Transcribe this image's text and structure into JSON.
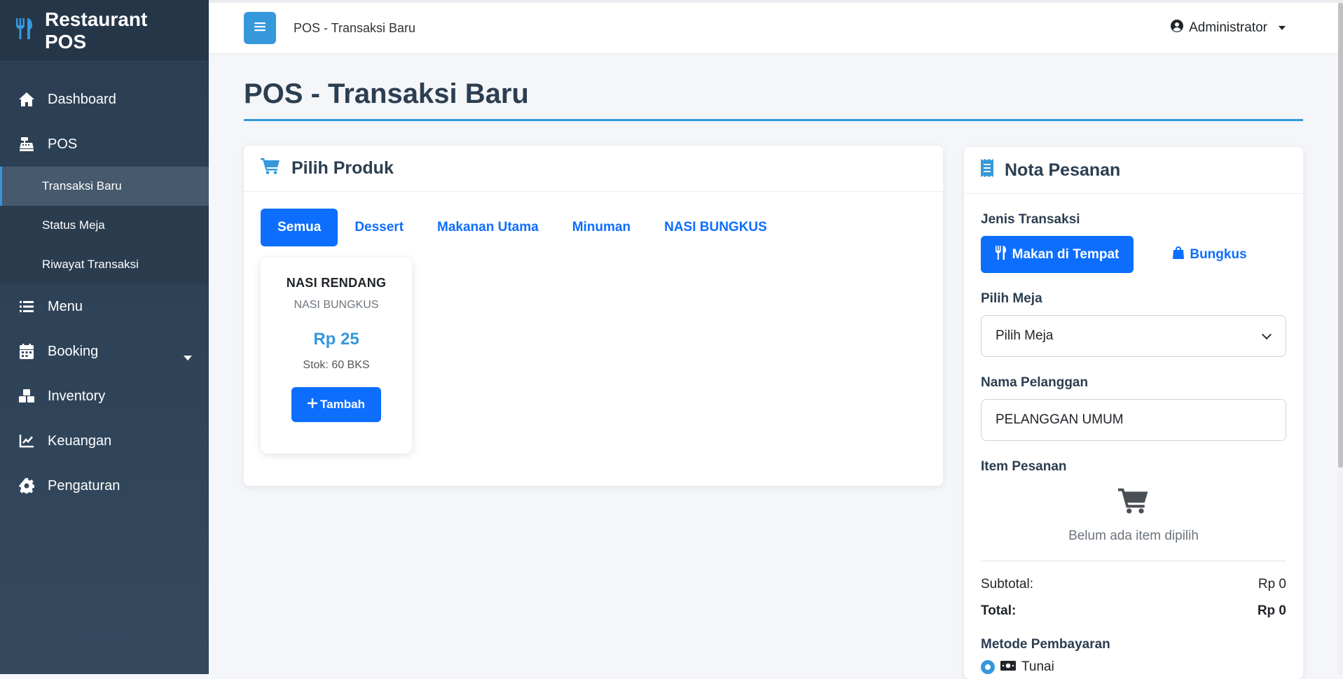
{
  "app": {
    "brand": "Restaurant POS"
  },
  "sidebar": {
    "items": [
      {
        "label": "Dashboard",
        "icon": "home-icon"
      },
      {
        "label": "POS",
        "icon": "cash-register-icon"
      },
      {
        "label": "Menu",
        "icon": "list-icon"
      },
      {
        "label": "Booking",
        "icon": "calendar-icon"
      },
      {
        "label": "Inventory",
        "icon": "boxes-icon"
      },
      {
        "label": "Keuangan",
        "icon": "chart-line-icon"
      },
      {
        "label": "Pengaturan",
        "icon": "gear-icon"
      }
    ],
    "pos_sub": [
      {
        "label": "Transaksi Baru"
      },
      {
        "label": "Status Meja"
      },
      {
        "label": "Riwayat Transaksi"
      }
    ]
  },
  "topbar": {
    "title": "POS - Transaksi Baru",
    "user": "Administrator"
  },
  "page": {
    "title": "POS - Transaksi Baru"
  },
  "products": {
    "header": "Pilih Produk",
    "tabs": [
      "Semua",
      "Dessert",
      "Makanan Utama",
      "Minuman",
      "NASI BUNGKUS"
    ],
    "items": [
      {
        "name": "NASI RENDANG",
        "category": "NASI BUNGKUS",
        "price": "Rp 25",
        "stock": "Stok: 60 BKS",
        "button": "Tambah"
      }
    ]
  },
  "order": {
    "header": "Nota Pesanan",
    "type_label": "Jenis Transaksi",
    "type_dine_in": "Makan di Tempat",
    "type_takeaway": "Bungkus",
    "table_label": "Pilih Meja",
    "table_value": "Pilih Meja",
    "customer_label": "Nama Pelanggan",
    "customer_value": "PELANGGAN UMUM",
    "items_label": "Item Pesanan",
    "empty_text": "Belum ada item dipilih",
    "subtotal_label": "Subtotal:",
    "subtotal_value": "Rp 0",
    "total_label": "Total:",
    "total_value": "Rp 0",
    "payment_label": "Metode Pembayaran",
    "payment_option": "Tunai"
  },
  "colors": {
    "accent": "#3498db",
    "primary": "#0d6efd",
    "sidebar": "#2c3e50"
  }
}
